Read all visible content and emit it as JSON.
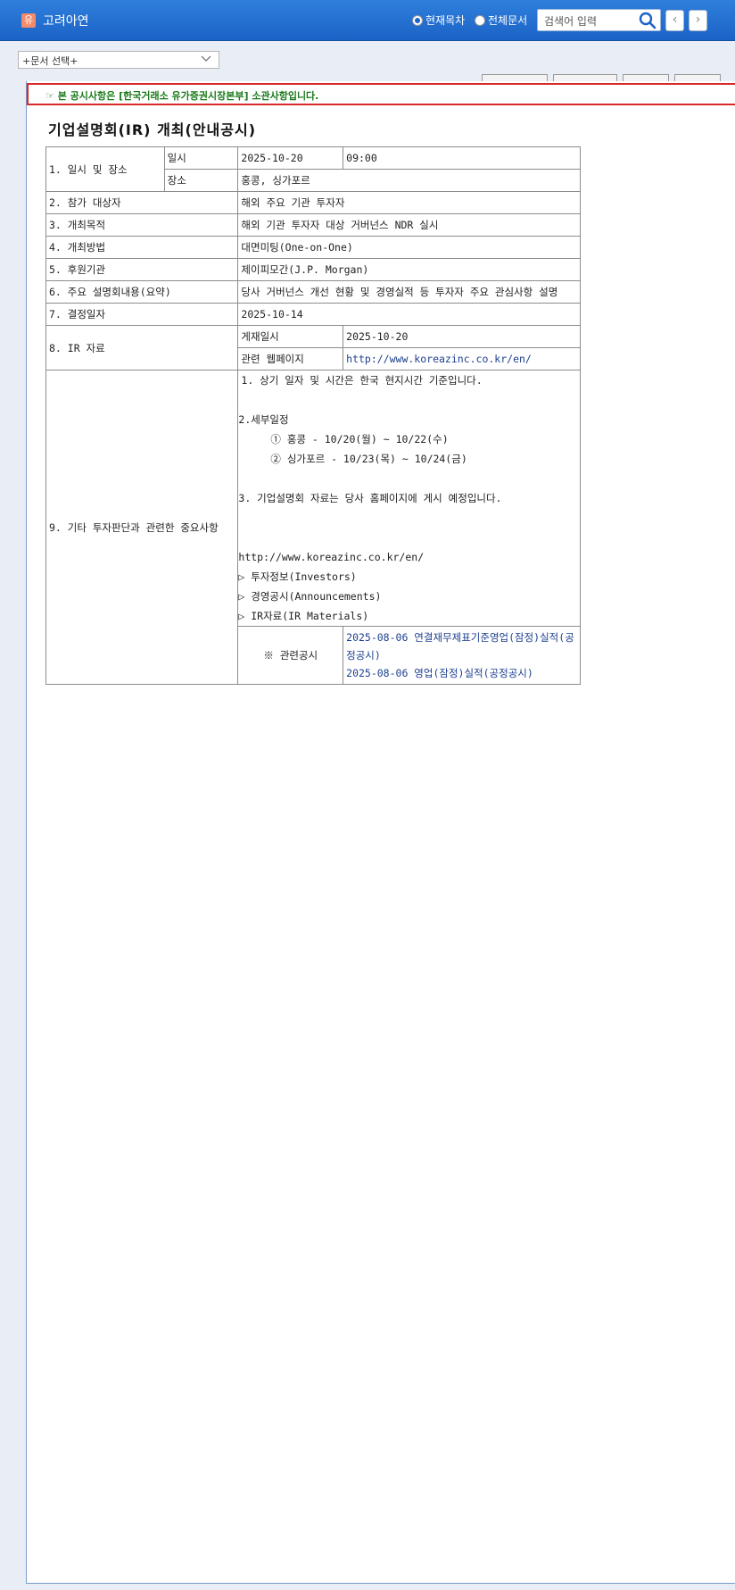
{
  "header": {
    "company_badge": "유",
    "company_name": "고려아연",
    "radio_current": "현재목차",
    "radio_all": "전체문서",
    "search_placeholder": "검색어 입력",
    "prev_glyph": "‹",
    "next_glyph": "›"
  },
  "toolbar": {
    "doc_select": "+문서 선택+"
  },
  "notice": "☞ 본 공시사항은 [한국거래소 유가증권시장본부] 소관사항입니다.",
  "doc_title": "기업설명회(IR) 개최(안내공시)",
  "report": {
    "r1_label": "1. 일시 및 장소",
    "r1_date_label": "일시",
    "r1_date": "2025-10-20",
    "r1_time": "09:00",
    "r1_place_label": "장소",
    "r1_place": "홍콩, 싱가포르",
    "r2_label": "2. 참가 대상자",
    "r2_value": "해외 주요 기관 투자자",
    "r3_label": "3. 개최목적",
    "r3_value": "해외 기관 투자자 대상 거버넌스 NDR 실시",
    "r4_label": "4. 개최방법",
    "r4_value": "대면미팅(One-on-One)",
    "r5_label": "5. 후원기관",
    "r5_value": "제이피모간(J.P. Morgan)",
    "r6_label": "6. 주요 설명회내용(요약)",
    "r6_value": "당사 거버넌스 개선 현황 및 경영실적 등 투자자 주요 관심사항 설명",
    "r7_label": "7. 결정일자",
    "r7_value": "2025-10-14",
    "r8_label": "8. IR 자료",
    "r8_post_label": "게재일시",
    "r8_post_value": "2025-10-20",
    "r8_web_label": "관련 웹페이지",
    "r8_web_value": "http://www.koreazinc.co.kr/en/",
    "r9_label": "9. 기타 투자판단과 관련한 중요사항",
    "r9_lines": {
      "l1": "1. 상기 일자 및 시간은 한국 현지시간 기준입니다.",
      "l2": "2.세부일정",
      "l3": "① 홍콩 - 10/20(월) ~ 10/22(수)",
      "l4": "② 싱가포르 - 10/23(목) ~ 10/24(금)",
      "l5": "3. 기업설명회 자료는 당사 홈페이지에 게시 예정입니다.",
      "l6": "http://www.koreazinc.co.kr/en/",
      "l7": "▷ 투자정보(Investors)",
      "l8": "▷ 경영공시(Announcements)",
      "l9": "▷ IR자료(IR Materials)"
    },
    "related_label": "※ 관련공시",
    "related_1": "2025-08-06 연결재무제표기준영업(잠정)실적(공정공시)",
    "related_2": "2025-08-06 영업(잠정)실적(공정공시)"
  }
}
